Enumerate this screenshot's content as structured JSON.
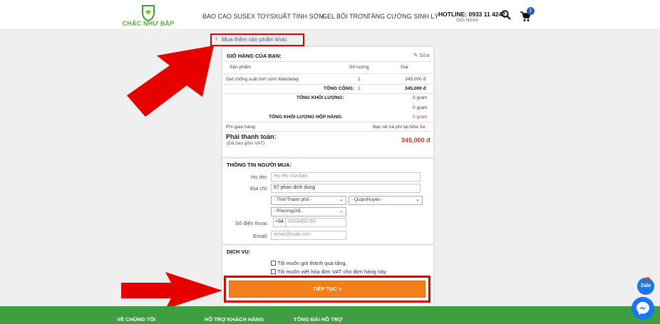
{
  "header": {
    "logo_text": "CHẮC NHƯ BẮP",
    "nav": [
      "BAO CAO SU",
      "SEX TOYS",
      "XUẤT TINH SỚM",
      "GEL BÔI TRƠN",
      "TĂNG CƯỜNG SINH LÝ"
    ],
    "hotline": "HOTLINE: 0933 11 4242",
    "call_label": "GỌI NGAY",
    "cart_count": "1"
  },
  "back_link": "Mua thêm sản phẩm khác",
  "cart": {
    "title": "GIỎ HÀNG CỦA BẠN:",
    "edit_label": "Sửa",
    "col_product": "Sản phẩm",
    "col_qty": "Số lượng",
    "col_price": "Giá",
    "item_name": "Gel chống xuất tinh sớm Mandelay",
    "item_qty": "1",
    "item_price": "345,000 đ",
    "total_label": "TỔNG CỘNG:",
    "total_qty": "1",
    "total_price": "345,000 đ",
    "weight_label": "TỔNG KHỐI LƯỢNG:",
    "weight_value": "0 gram",
    "weight_value2": "0 gram",
    "box_weight_label": "TỔNG KHỐI LƯỢNG HỘP HÀNG:",
    "box_weight_value": "0 gram",
    "shipping_label": "Phí giao hàng:",
    "shipping_value": "Bạn sẽ trả phí tại Nhà Xe",
    "pay_label": "Phải thanh toán:",
    "pay_sub": "(Đã bao gồm VAT)",
    "pay_value": "345,000 đ"
  },
  "buyer": {
    "title": "THÔNG TIN NGƯỜI MUA:",
    "name_label": "Họ tên:",
    "name_placeholder": "Họ tên của bạn",
    "address_label": "Địa chỉ:",
    "address_value": "67 phan dinh dung",
    "province_select": "- Tỉnh/Thành phố -",
    "district_select": "- Quận/Huyện -",
    "ward_select": "- Phường/Xã -",
    "phone_label": "Số điện thoại:",
    "phone_prefix": "+84",
    "phone_placeholder": "0903456789",
    "email_label": "Email:",
    "email_placeholder": "email@mail.com"
  },
  "service": {
    "title": "DỊCH VỤ:",
    "gift_label": "Tôi muốn gói thành quà tặng.",
    "vat_label": "Tôi muốn viết hóa đơn VAT cho đơn hàng này"
  },
  "continue_label": "TIẾP TỤC »",
  "footer": [
    "VỀ CHÚNG TÔI",
    "HỖ TRỢ KHÁCH HÀNG",
    "TỔNG ĐÀI HỖ TRỢ"
  ],
  "zalo_label": "Zalo",
  "colors": {
    "accent_orange": "#f57e1c",
    "highlight_red": "#e10000",
    "footer_green": "#3e9f41",
    "price_red": "#e23333"
  }
}
